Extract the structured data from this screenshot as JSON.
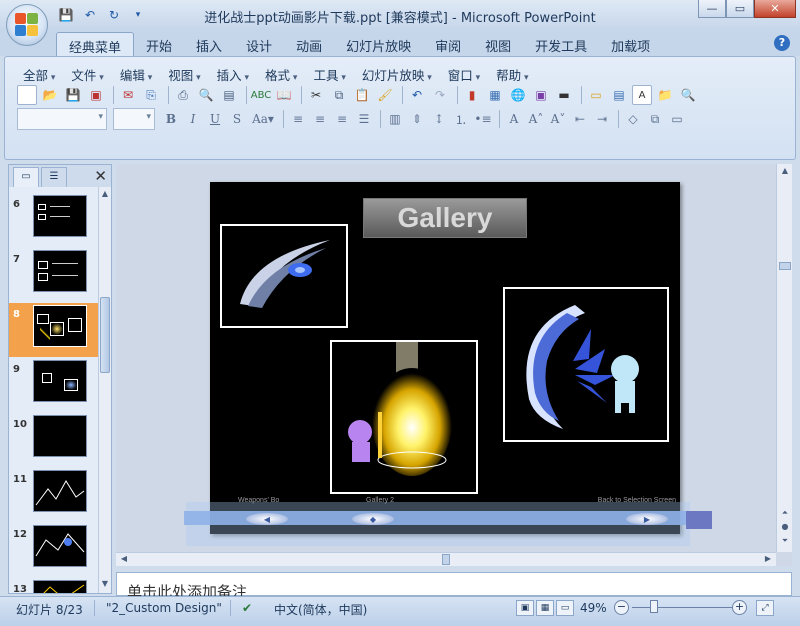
{
  "window": {
    "title": "进化战士ppt动画影片下载.ppt [兼容模式] - Microsoft PowerPoint"
  },
  "ribbon_tabs": [
    {
      "label": "经典菜单",
      "active": true
    },
    {
      "label": "开始"
    },
    {
      "label": "插入"
    },
    {
      "label": "设计"
    },
    {
      "label": "动画"
    },
    {
      "label": "幻灯片放映"
    },
    {
      "label": "审阅"
    },
    {
      "label": "视图"
    },
    {
      "label": "开发工具"
    },
    {
      "label": "加载项"
    }
  ],
  "classic_menu": [
    "全部",
    "文件",
    "编辑",
    "视图",
    "插入",
    "格式",
    "工具",
    "幻灯片放映",
    "窗口",
    "帮助"
  ],
  "slide_thumbnails": [
    {
      "number": "6"
    },
    {
      "number": "7"
    },
    {
      "number": "8",
      "selected": true
    },
    {
      "number": "9"
    },
    {
      "number": "10"
    },
    {
      "number": "11"
    },
    {
      "number": "12"
    },
    {
      "number": "13"
    }
  ],
  "slide": {
    "title": "Gallery",
    "caption_left": "Weapons' Bo",
    "caption_center": "Gallery 2",
    "caption_right": "Back to Selection Screen"
  },
  "notes": {
    "placeholder": "单击此处添加备注"
  },
  "status": {
    "slide_counter": "幻灯片 8/23",
    "design": "\"2_Custom Design\"",
    "language": "中文(简体，中国)",
    "zoom": "49%"
  },
  "colors": {
    "accent": "#f3a24b",
    "ribbon": "#dde9f7",
    "nav_bar": "#8fb1e8"
  }
}
